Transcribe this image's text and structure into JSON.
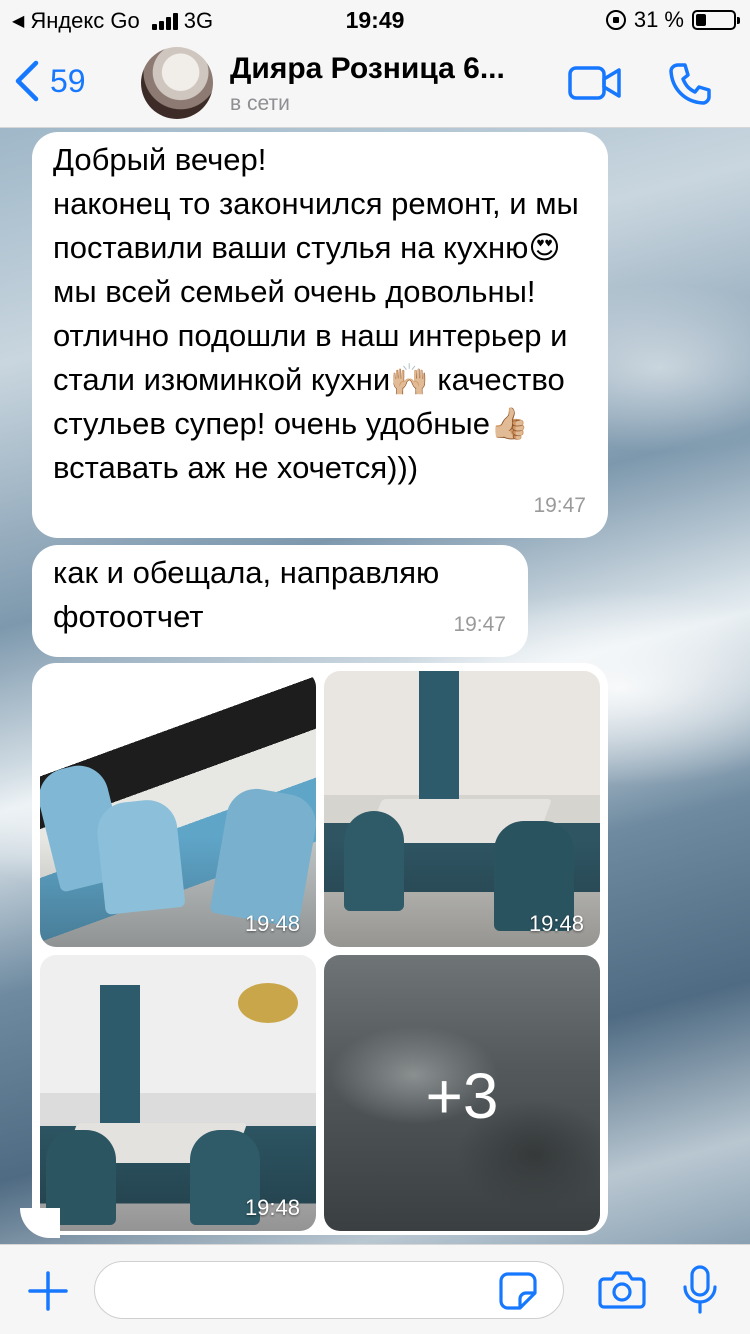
{
  "status_bar": {
    "back_app": "Яндекс Go",
    "network": "3G",
    "time": "19:49",
    "battery": "31 %"
  },
  "header": {
    "back_count": "59",
    "contact_name": "Дияра Розница 6...",
    "contact_status": "в сети"
  },
  "messages": [
    {
      "text": "Добрый вечер!\nнаконец то закончился ремонт, и мы поставили ваши стулья на кухню😍 мы всей семьей очень довольны! отлично подошли в наш интерьер и стали изюминкой кухни🙌🏼 качество стульев супер! очень удобные👍🏼 вставать аж не хочется)))",
      "time": "19:47"
    },
    {
      "text": "как и обещала, направляю фотоотчет",
      "time": "19:47"
    }
  ],
  "media": {
    "photos": [
      {
        "time": "19:48"
      },
      {
        "time": "19:48"
      },
      {
        "time": "19:48"
      }
    ],
    "more_label": "+3"
  },
  "input": {
    "placeholder": ""
  },
  "colors": {
    "accent": "#1677ff",
    "bubble": "#ffffff",
    "timestamp": "#9a9a9a"
  },
  "icons": [
    "chevron-left-icon",
    "signal-icon",
    "lock-rotation-icon",
    "battery-icon",
    "video-camera-icon",
    "phone-icon",
    "plus-icon",
    "sticker-icon",
    "camera-icon",
    "microphone-icon"
  ]
}
